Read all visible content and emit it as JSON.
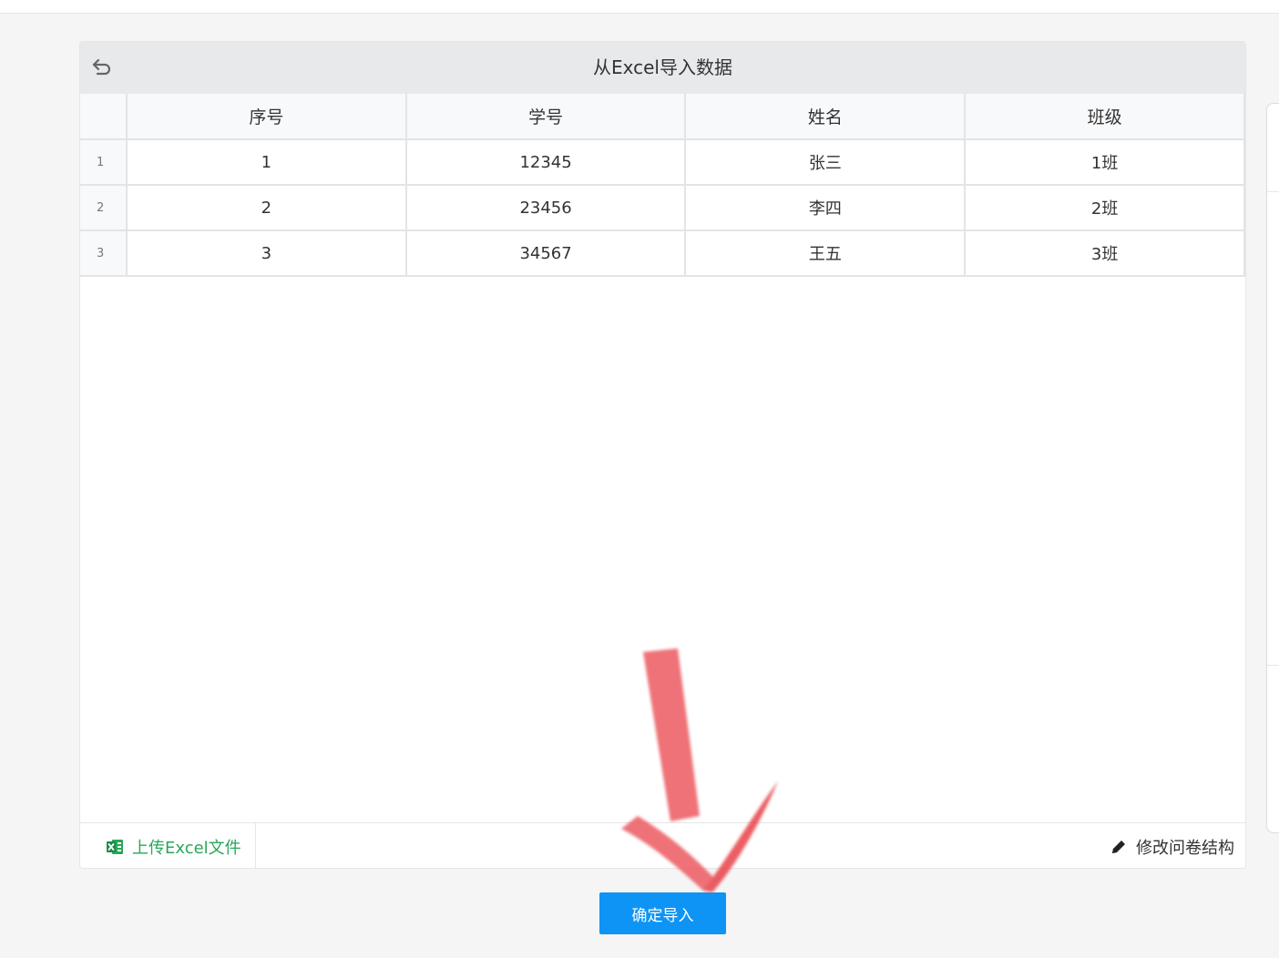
{
  "dialog": {
    "title": "从Excel导入数据"
  },
  "table": {
    "columns": [
      "序号",
      "学号",
      "姓名",
      "班级"
    ],
    "rows": [
      {
        "row_number": "1",
        "cells": [
          "1",
          "12345",
          "张三",
          "1班"
        ]
      },
      {
        "row_number": "2",
        "cells": [
          "2",
          "23456",
          "李四",
          "2班"
        ]
      },
      {
        "row_number": "3",
        "cells": [
          "3",
          "34567",
          "王五",
          "3班"
        ]
      }
    ]
  },
  "footer": {
    "upload_label": "上传Excel文件",
    "edit_label": "修改问卷结构"
  },
  "actions": {
    "confirm_label": "确定导入"
  },
  "colors": {
    "primary": "#0e94f5",
    "excel_green": "#2aa65a",
    "annotation_red": "#e8434a"
  },
  "icons": [
    "undo-icon",
    "excel-icon",
    "pencil-icon",
    "annotation-arrow"
  ]
}
